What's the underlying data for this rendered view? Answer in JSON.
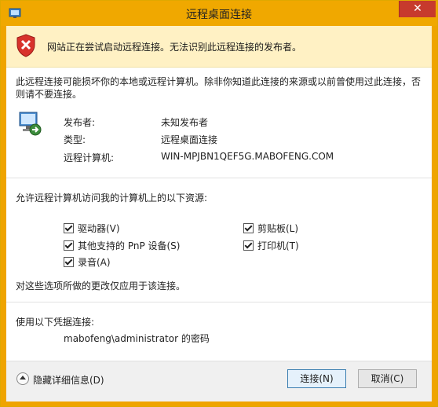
{
  "window": {
    "title": "远程桌面连接",
    "close": "✕"
  },
  "warning": {
    "text": "网站正在尝试启动远程连接。无法识别此远程连接的发布者。"
  },
  "description": "此远程连接可能损坏你的本地或远程计算机。除非你知道此连接的来源或以前曾使用过此连接，否则请不要连接。",
  "details": {
    "publisher_label": "发布者:",
    "publisher_value": "未知发布者",
    "type_label": "类型:",
    "type_value": "远程桌面连接",
    "computer_label": "远程计算机:",
    "computer_value": "WIN-MPJBN1QEF5G.MABOFENG.COM"
  },
  "resources": {
    "title": "允许远程计算机访问我的计算机上的以下资源:",
    "items": [
      {
        "label": "驱动器(V)",
        "checked": true
      },
      {
        "label": "剪贴板(L)",
        "checked": true
      },
      {
        "label": "其他支持的 PnP 设备(S)",
        "checked": true
      },
      {
        "label": "打印机(T)",
        "checked": true
      },
      {
        "label": "录音(A)",
        "checked": true
      }
    ],
    "note": "对这些选项所做的更改仅应用于该连接。"
  },
  "credentials": {
    "title": "使用以下凭据连接:",
    "value": "mabofeng\\administrator 的密码"
  },
  "footer": {
    "toggle_label": "隐藏详细信息(D)",
    "connect_label": "连接(N)",
    "cancel_label": "取消(C)"
  },
  "colors": {
    "titlebar": "#f0a800",
    "warning_bg": "#fff1c4",
    "close": "#c73a2d"
  },
  "icons": [
    "app-icon",
    "shield-error-icon",
    "remote-desktop-icon",
    "collapse-icon"
  ]
}
